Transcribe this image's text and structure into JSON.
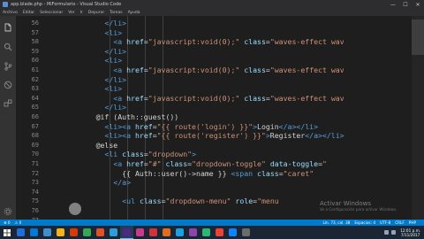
{
  "window": {
    "title": "app.blade.php - MiFormulario - Visual Studio Code",
    "minimize": "—",
    "maximize": "☐",
    "close": "✕"
  },
  "menu": [
    "Archivo",
    "Editar",
    "Seleccionar",
    "Ver",
    "Ir",
    "Depurar",
    "Tareas",
    "Ayuda"
  ],
  "gutter": [
    "56",
    "57",
    "58",
    "59",
    "60",
    "61",
    "62",
    "63",
    "64",
    "65",
    "66",
    "67",
    "68",
    "69",
    "70",
    "71",
    "72",
    "73",
    "74",
    "75",
    "76",
    "77"
  ],
  "code": [
    [
      {
        "t": "tag",
        "v": "</li>"
      }
    ],
    [
      {
        "t": "tag",
        "v": "<li>"
      }
    ],
    [
      {
        "t": "tag",
        "v": "<a "
      },
      {
        "t": "attr",
        "v": "href"
      },
      {
        "t": "text",
        "v": "="
      },
      {
        "t": "str",
        "v": "\"javascript:void(0);\""
      },
      {
        "t": "text",
        "v": " "
      },
      {
        "t": "attr",
        "v": "class"
      },
      {
        "t": "text",
        "v": "="
      },
      {
        "t": "str",
        "v": "\"waves-effect wav"
      }
    ],
    [
      {
        "t": "tag",
        "v": "</li>"
      }
    ],
    [
      {
        "t": "tag",
        "v": "<li>"
      }
    ],
    [
      {
        "t": "tag",
        "v": "<a "
      },
      {
        "t": "attr",
        "v": "href"
      },
      {
        "t": "text",
        "v": "="
      },
      {
        "t": "str",
        "v": "\"javascript:void(0);\""
      },
      {
        "t": "text",
        "v": " "
      },
      {
        "t": "attr",
        "v": "class"
      },
      {
        "t": "text",
        "v": "="
      },
      {
        "t": "str",
        "v": "\"waves-effect wav"
      }
    ],
    [
      {
        "t": "tag",
        "v": "</li>"
      }
    ],
    [
      {
        "t": "tag",
        "v": "<li>"
      }
    ],
    [
      {
        "t": "tag",
        "v": "<a "
      },
      {
        "t": "attr",
        "v": "href"
      },
      {
        "t": "text",
        "v": "="
      },
      {
        "t": "str",
        "v": "\"javascript:void(0);\""
      },
      {
        "t": "text",
        "v": " "
      },
      {
        "t": "attr",
        "v": "class"
      },
      {
        "t": "text",
        "v": "="
      },
      {
        "t": "str",
        "v": "\"waves-effect wav"
      }
    ],
    [
      {
        "t": "tag",
        "v": "</li>"
      }
    ],
    [
      {
        "t": "text",
        "v": "@if (Auth::guest())"
      }
    ],
    [
      {
        "t": "tag",
        "v": "<li><a "
      },
      {
        "t": "attr",
        "v": "href"
      },
      {
        "t": "text",
        "v": "="
      },
      {
        "t": "str",
        "v": "\"{{ route('login') }}\""
      },
      {
        "t": "tag",
        "v": ">"
      },
      {
        "t": "text",
        "v": "Login"
      },
      {
        "t": "tag",
        "v": "</a></li>"
      }
    ],
    [
      {
        "t": "tag",
        "v": "<li><a "
      },
      {
        "t": "attr",
        "v": "href"
      },
      {
        "t": "text",
        "v": "="
      },
      {
        "t": "str",
        "v": "\"{{ route('register') }}\""
      },
      {
        "t": "tag",
        "v": ">"
      },
      {
        "t": "text",
        "v": "Register"
      },
      {
        "t": "tag",
        "v": "</a></li>"
      }
    ],
    [
      {
        "t": "text",
        "v": "@else"
      }
    ],
    [
      {
        "t": "tag",
        "v": "<li "
      },
      {
        "t": "attr",
        "v": "class"
      },
      {
        "t": "text",
        "v": "="
      },
      {
        "t": "str",
        "v": "\"dropdown\""
      },
      {
        "t": "tag",
        "v": ">"
      }
    ],
    [
      {
        "t": "tag",
        "v": "<a "
      },
      {
        "t": "attr",
        "v": "href"
      },
      {
        "t": "text",
        "v": "="
      },
      {
        "t": "str",
        "v": "\"#\""
      },
      {
        "t": "text",
        "v": " "
      },
      {
        "t": "attr",
        "v": "class"
      },
      {
        "t": "text",
        "v": "="
      },
      {
        "t": "str",
        "v": "\"dropdown-toggle\""
      },
      {
        "t": "text",
        "v": " "
      },
      {
        "t": "attr",
        "v": "data-toggle"
      },
      {
        "t": "text",
        "v": "="
      },
      {
        "t": "str",
        "v": "\""
      }
    ],
    [
      {
        "t": "text",
        "v": "{{ Auth::user()->name }} "
      },
      {
        "t": "tag",
        "v": "<span "
      },
      {
        "t": "attr",
        "v": "class"
      },
      {
        "t": "text",
        "v": "="
      },
      {
        "t": "str",
        "v": "\"caret\""
      }
    ],
    [
      {
        "t": "tag",
        "v": "</a>"
      }
    ],
    [],
    [
      {
        "t": "tag",
        "v": "<ul "
      },
      {
        "t": "attr",
        "v": "class"
      },
      {
        "t": "text",
        "v": "="
      },
      {
        "t": "str",
        "v": "\"dropdown-menu\""
      },
      {
        "t": "text",
        "v": " "
      },
      {
        "t": "attr",
        "v": "role"
      },
      {
        "t": "text",
        "v": "="
      },
      {
        "t": "str",
        "v": "\"menu"
      }
    ],
    [],
    []
  ],
  "indents": [
    9,
    9,
    11,
    9,
    9,
    11,
    9,
    9,
    11,
    9,
    7,
    9,
    9,
    7,
    9,
    11,
    13,
    11,
    11,
    13,
    11,
    11
  ],
  "watermark": {
    "title": "Activar Windows",
    "subtitle": "Ve a Configuración para activar Windows."
  },
  "statusbar": {
    "left": [
      "⊗ 0",
      "⚠ 0"
    ],
    "right": [
      "Lín. 73, col. 38",
      "Espacios: 4",
      "UTF-8",
      "CRLF",
      "PHP"
    ]
  },
  "taskbar": {
    "apps": [
      "#1e6fd9",
      "#0078d7",
      "#3e8ed0",
      "#f2b21c",
      "#d83b01",
      "#34a853",
      "#e34f26",
      "#2d9cdb",
      "#4b2a86",
      "#c93a8b",
      "#d13438",
      "#e16b1f",
      "#1aa1e2",
      "#8e44ad",
      "#2bb673",
      "#ea4335",
      "#0a84ff",
      "#6b6b6b"
    ],
    "active_index": 8,
    "time": "12:01 p.m.",
    "date": "7/11/2017"
  },
  "colors": {
    "accent": "#007acc",
    "background": "#1e1e1e"
  }
}
